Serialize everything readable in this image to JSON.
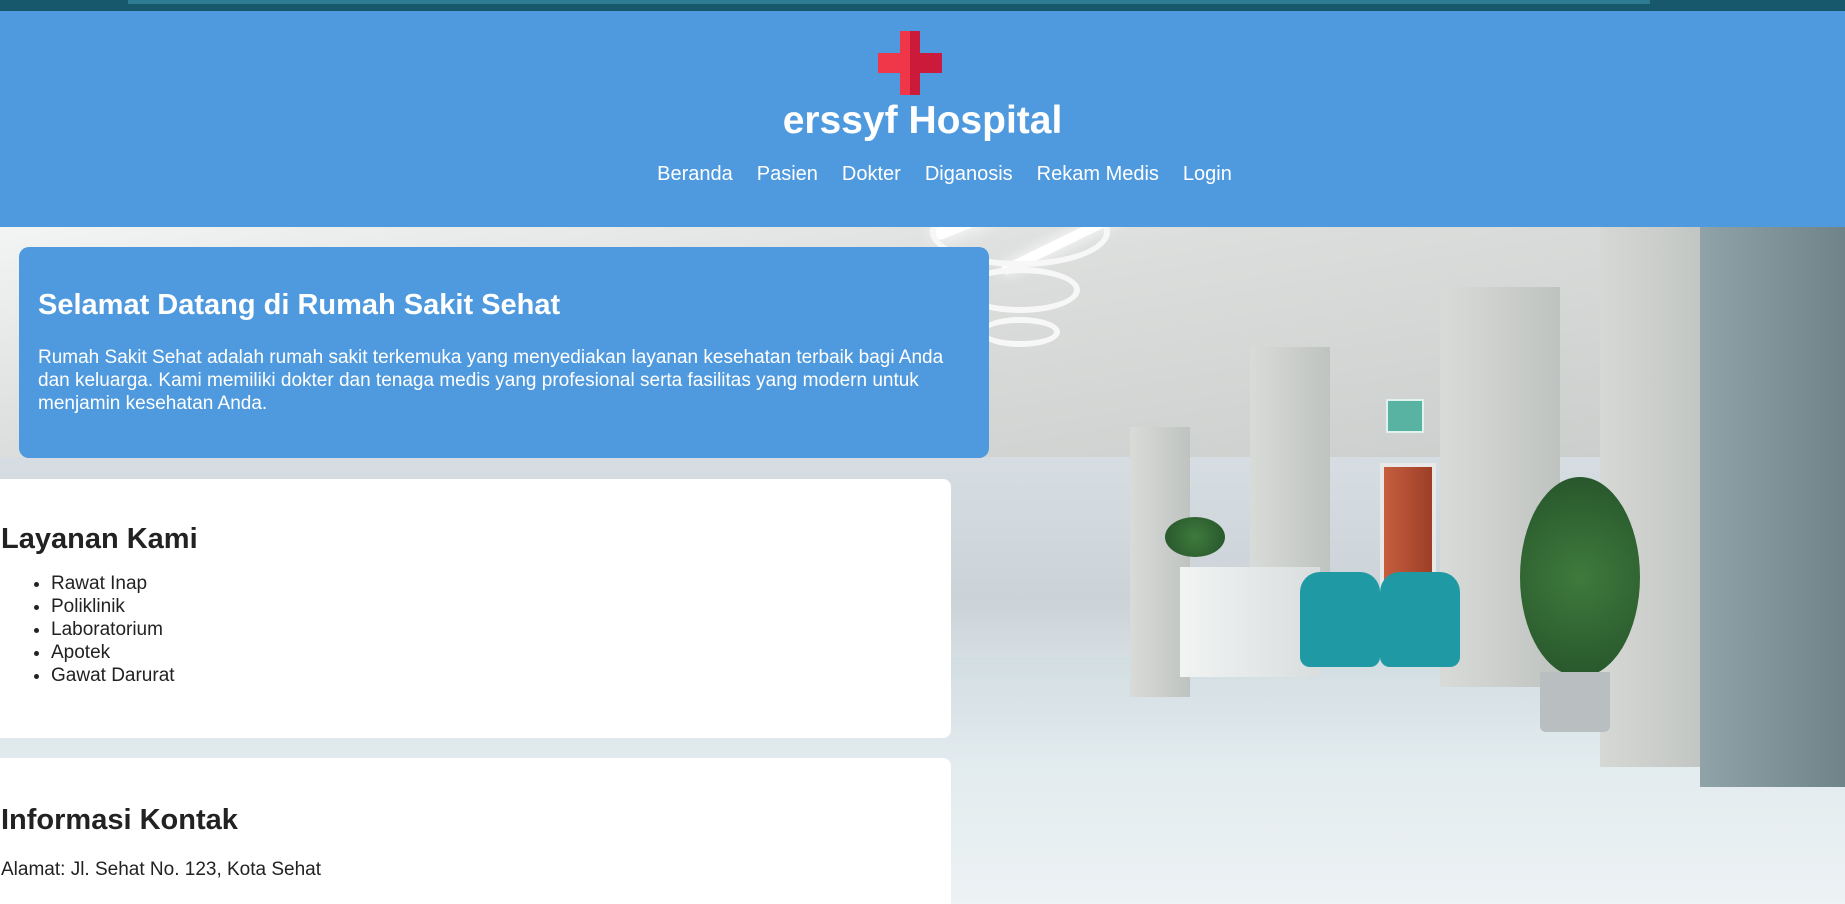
{
  "header": {
    "logo_icon": "medical-cross-icon",
    "title": "erssyf Hospital",
    "nav": [
      {
        "label": "Beranda"
      },
      {
        "label": "Pasien"
      },
      {
        "label": "Dokter"
      },
      {
        "label": "Diganosis"
      },
      {
        "label": "Rekam Medis"
      },
      {
        "label": "Login"
      }
    ]
  },
  "welcome": {
    "heading": "Selamat Datang di Rumah Sakit Sehat",
    "text": "Rumah Sakit Sehat adalah rumah sakit terkemuka yang menyediakan layanan kesehatan terbaik bagi Anda dan keluarga. Kami memiliki dokter dan tenaga medis yang profesional serta fasilitas yang modern untuk menjamin kesehatan Anda."
  },
  "services": {
    "heading": "Layanan Kami",
    "items": [
      "Rawat Inap",
      "Poliklinik",
      "Laboratorium",
      "Apotek",
      "Gawat Darurat"
    ]
  },
  "contact": {
    "heading": "Informasi Kontak",
    "address": "Alamat: Jl. Sehat No. 123, Kota Sehat"
  },
  "colors": {
    "header_bg": "#4f9ade",
    "topbar": "#17586c",
    "logo_cross": "#e8263f",
    "card_bg": "#ffffff"
  },
  "hero_background": "hospital-corridor-image"
}
